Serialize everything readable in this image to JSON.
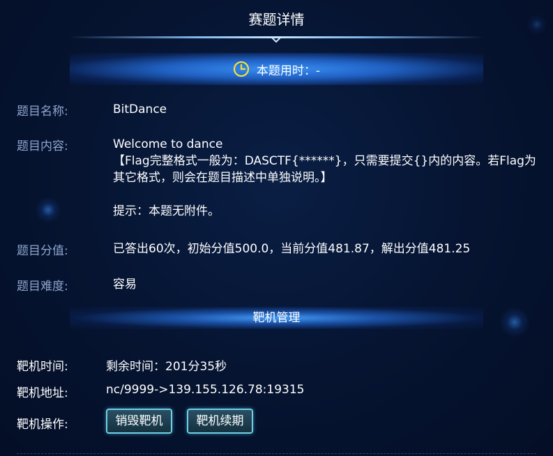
{
  "header": {
    "title": "赛题详情"
  },
  "timer": {
    "label": "本题用时：-"
  },
  "challenge": {
    "name_label": "题目名称:",
    "name_value": "BitDance",
    "content_label": "题目内容:",
    "content_lines": [
      "Welcome to dance",
      "【Flag完整格式一般为：DASCTF{******}，只需要提交{}内的内容。若Flag为",
      "其它格式，则会在题目描述中单独说明。】",
      "",
      "提示：本题无附件。"
    ],
    "score_label": "题目分值:",
    "score_value": "已答出60次，初始分值500.0，当前分值481.87，解出分值481.25",
    "difficulty_label": "题目难度:",
    "difficulty_value": "容易"
  },
  "target": {
    "section_title": "靶机管理",
    "time_label": "靶机时间:",
    "time_value": "剩余时间：201分35秒",
    "address_label": "靶机地址:",
    "address_value": "nc/9999->139.155.126.78:19315",
    "ops_label": "靶机操作:",
    "destroy_button": "销毁靶机",
    "renew_button": "靶机续期"
  },
  "colors": {
    "label_blue": "#8fa6cf",
    "accent_blue": "#3c96ff",
    "button_border": "#6fd0e8",
    "clock_yellow": "#f3e23a"
  },
  "icons": {
    "timer": "clock-icon"
  }
}
